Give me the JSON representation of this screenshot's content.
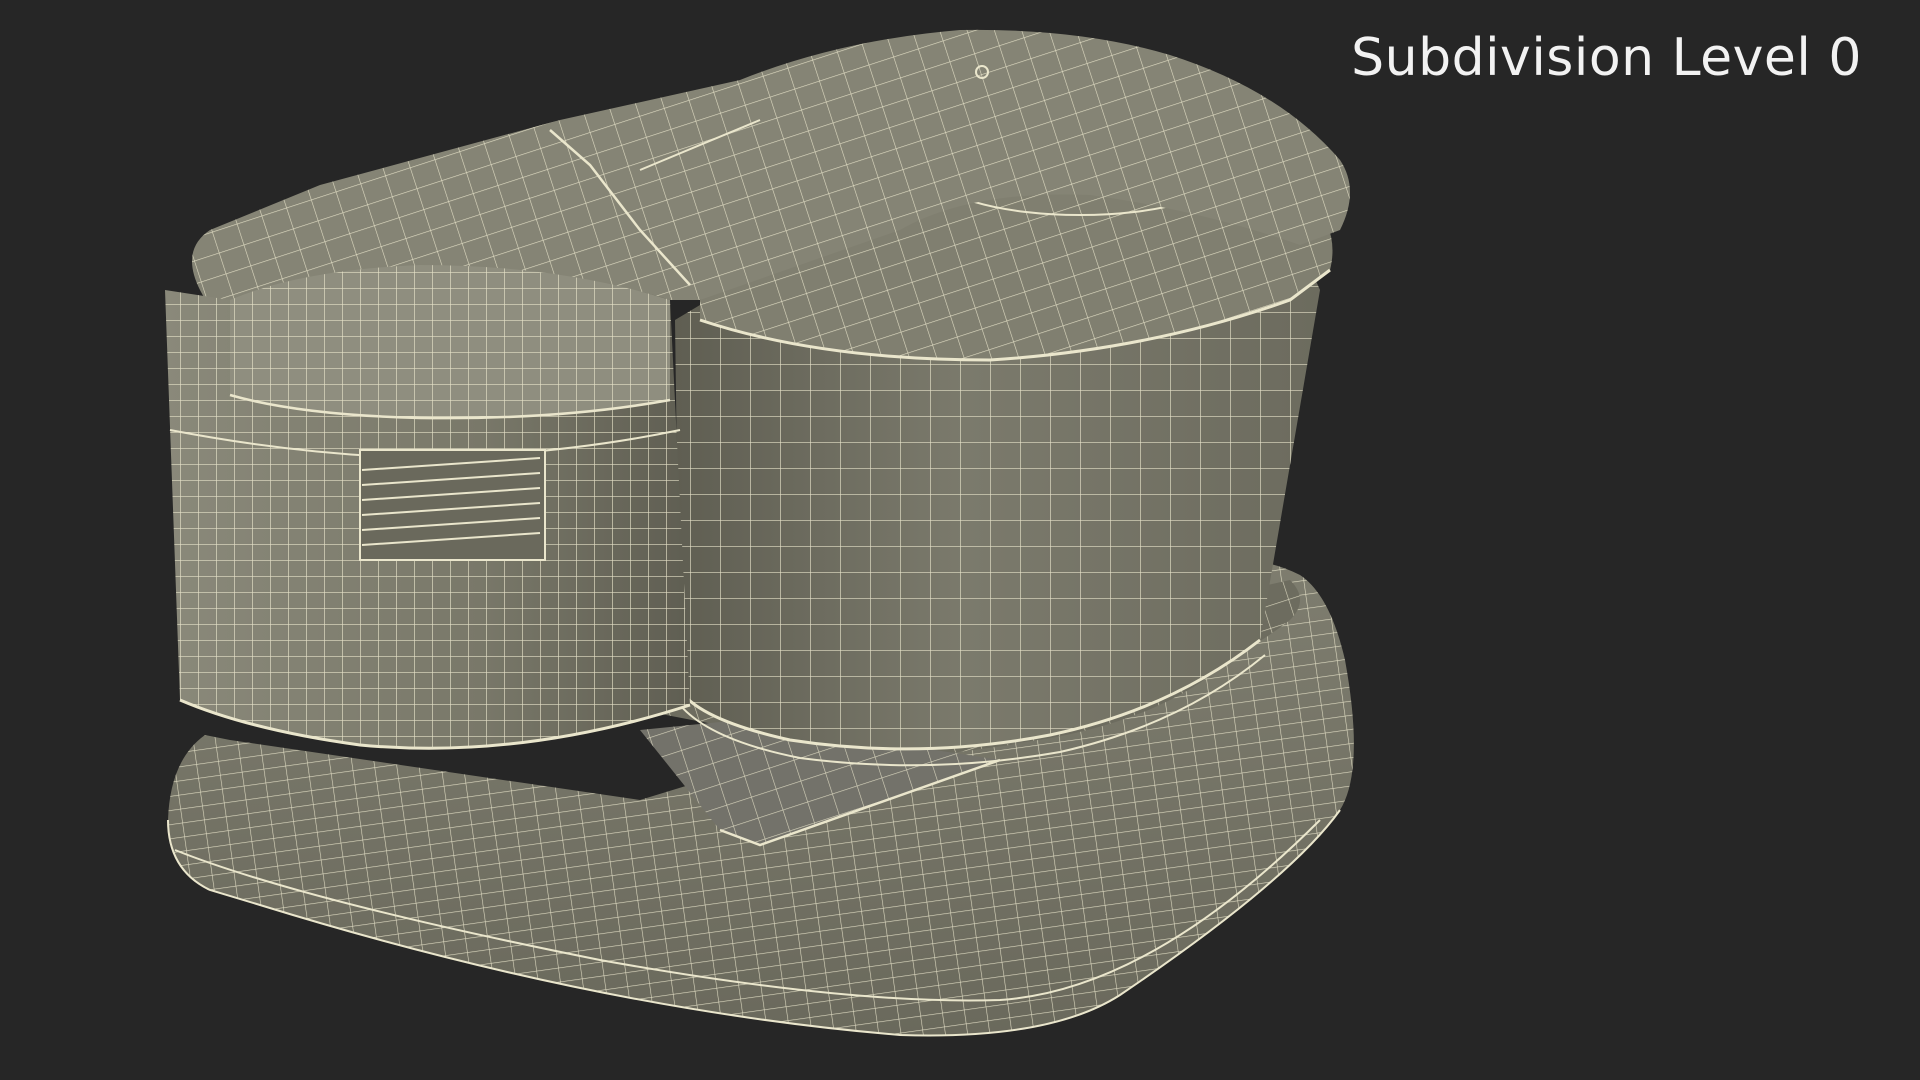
{
  "render": {
    "title": "Subdivision Level 0",
    "subject": "wet-grinder-wireframe-model",
    "colors": {
      "background": "#262626",
      "surface": "#79786a",
      "surface_light": "#8a897a",
      "surface_dark": "#5f5e52",
      "wire": "#eae6cc",
      "title_text": "#f2f2f2"
    }
  }
}
